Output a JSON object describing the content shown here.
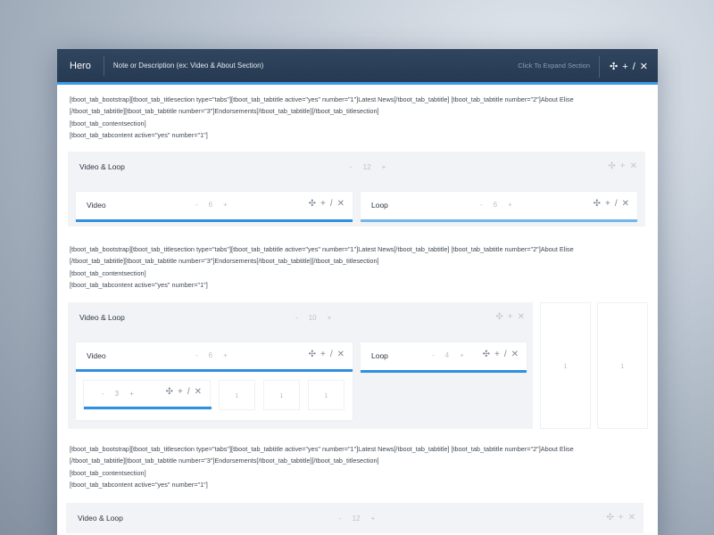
{
  "header": {
    "title": "Hero",
    "description": "Note or Description (ex: Video & About Section)",
    "expand_label": "Click To Expand Section",
    "controls": [
      "move-icon",
      "add-icon",
      "edit-icon",
      "close-icon"
    ]
  },
  "code_lines": [
    "[tboot_tab_bootstrap][tboot_tab_titlesection type=\"tabs\"][tboot_tab_tabtitle active=\"yes\" number=\"1\"]Latest News[/tboot_tab_tabtitle] [tboot_tab_tabtitle number=\"2\"]About Elise",
    "[/tboot_tab_tabtitle][tboot_tab_tabtitle number=\"3\"]Endorsements[/tboot_tab_tabtitle][/tboot_tab_titlesection]",
    "[tboot_tab_contentsection]",
    "[tboot_tab_tabcontent active=\"yes\" number=\"1\"]"
  ],
  "code_lines_b": [
    "[tboot_tab_bootstrap][tboot_tab_titlesection type=\"tabs\"][tboot_tab_tabtitle active=\"yes\" number=\"1\"]Latest News[/tboot_tab_tabtitle] [tboot_tab_tabtitle number=\"2\"]About Elise",
    "[/tboot_tab_tabtitle][tboot_tab_tabtitle number=\"3\"]Endorsements[/tboot_tab_tabtitle][/tboot_tab_titlesection]",
    "[tboot_tab_contentsection]",
    "[tboot_tab_tabcontent active=\"yes\" number=\"1\"]"
  ],
  "code_lines_c": [
    "[tboot_tab_bootstrap][tboot_tab_titlesection type=\"tabs\"][tboot_tab_tabtitle active=\"yes\" number=\"1\"]Latest News[/tboot_tab_tabtitle] [tboot_tab_tabtitle number=\"2\"]About Elise",
    "[/tboot_tab_tabtitle][tboot_tab_tabtitle number=\"3\"]Endorsements[/tboot_tab_tabtitle][/tboot_tab_titlesection]",
    "[tboot_tab_contentsection]",
    "[tboot_tab_tabcontent active=\"yes\" number=\"1\"]"
  ],
  "row1": {
    "label": "Video & Loop",
    "minus": "-",
    "cols": "12",
    "plus": "+"
  },
  "row1_video": {
    "label": "Video",
    "minus": "-",
    "cols": "6",
    "plus": "+"
  },
  "row1_loop": {
    "label": "Loop",
    "minus": "-",
    "cols": "6",
    "plus": "+"
  },
  "row2": {
    "label": "Video & Loop",
    "minus": "-",
    "cols": "10",
    "plus": "+"
  },
  "row2_video": {
    "label": "Video",
    "minus": "-",
    "cols": "6",
    "plus": "+"
  },
  "row2_loop": {
    "label": "Loop",
    "minus": "-",
    "cols": "4",
    "plus": "+"
  },
  "row2_inner": {
    "minus": "-",
    "cols": "3",
    "plus": "+"
  },
  "row2_minis": [
    "1",
    "1",
    "1"
  ],
  "row2_sidecols": [
    "1",
    "1"
  ],
  "row3": {
    "label": "Video & Loop",
    "minus": "-",
    "cols": "12",
    "plus": "+"
  },
  "icons": {
    "move": "✣",
    "add": "+",
    "edit": "/",
    "close": "✕"
  }
}
